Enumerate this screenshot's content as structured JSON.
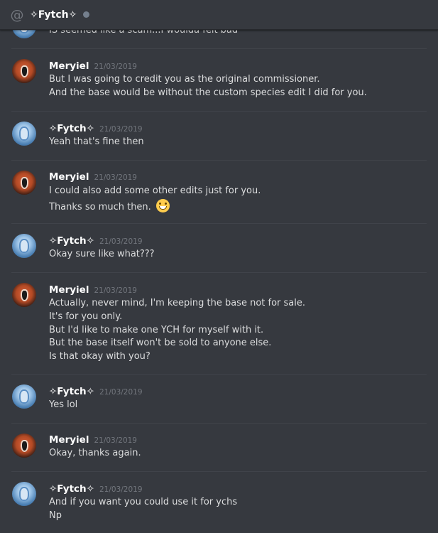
{
  "header": {
    "channel_name": "✧Fytch✧",
    "icon": "at-icon",
    "status": "offline"
  },
  "partial_message": {
    "text": "IS seemed like a scam...I woulda felt bad"
  },
  "messages": [
    {
      "author": "Meryiel",
      "timestamp": "21/03/2019",
      "lines": [
        "But I was going to credit you as the original commissioner.",
        "And the base would be without the custom species edit I did for you."
      ]
    },
    {
      "author": "✧Fytch✧",
      "timestamp": "21/03/2019",
      "lines": [
        "Yeah that's fine then"
      ]
    },
    {
      "author": "Meryiel",
      "timestamp": "21/03/2019",
      "lines": [
        "I could also add some other edits just for you.",
        "Thanks so much then."
      ],
      "emoji": "grinning-face-with-smiling-eyes"
    },
    {
      "author": "✧Fytch✧",
      "timestamp": "21/03/2019",
      "lines": [
        "Okay sure like what???"
      ]
    },
    {
      "author": "Meryiel",
      "timestamp": "21/03/2019",
      "lines": [
        "Actually, never mind, I'm keeping the base not for sale.",
        "It's for you only.",
        "But I'd like to make one YCH for myself with it.",
        "But the base itself won't be sold to anyone else.",
        "Is that okay with you?"
      ]
    },
    {
      "author": "✧Fytch✧",
      "timestamp": "21/03/2019",
      "lines": [
        "Yes lol"
      ]
    },
    {
      "author": "Meryiel",
      "timestamp": "21/03/2019",
      "lines": [
        "Okay, thanks again."
      ]
    },
    {
      "author": "✧Fytch✧",
      "timestamp": "21/03/2019",
      "lines": [
        "And if you want you could use it for ychs",
        "Np"
      ]
    }
  ]
}
